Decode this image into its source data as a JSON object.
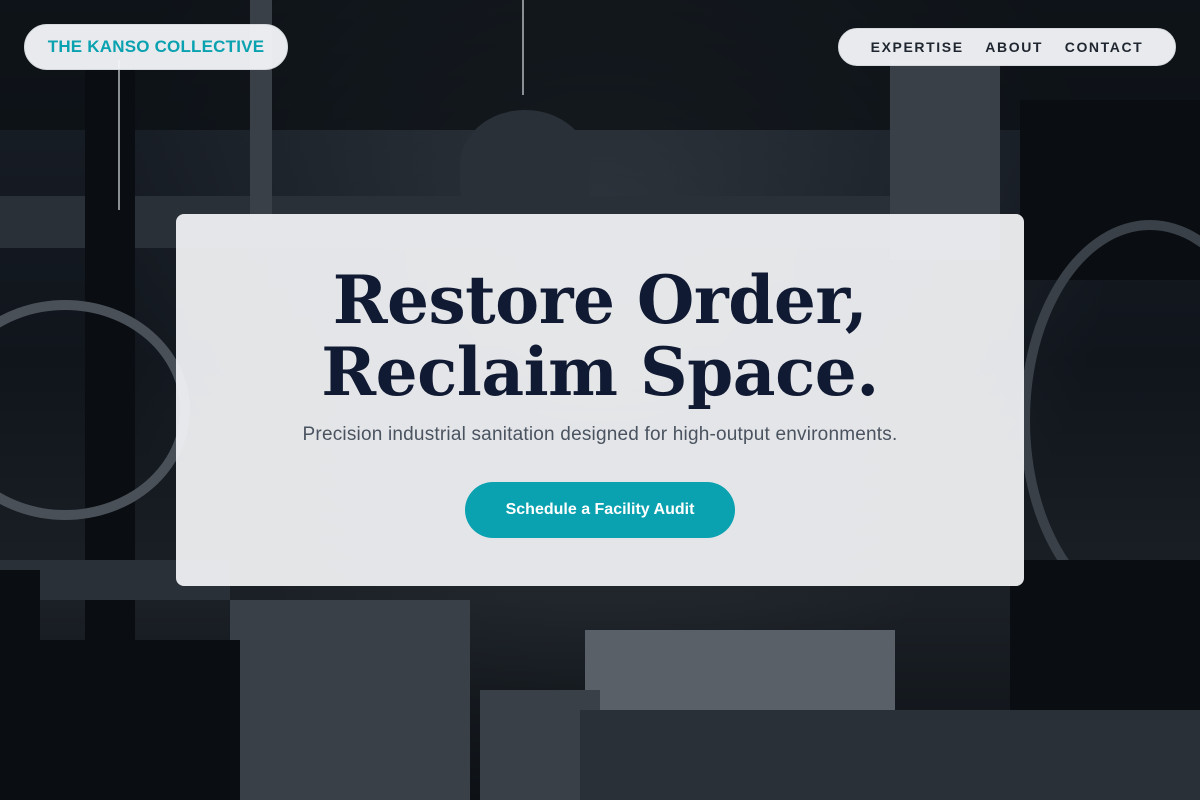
{
  "brand": {
    "name": "THE KANSO COLLECTIVE"
  },
  "nav": {
    "items": [
      "EXPERTISE",
      "ABOUT",
      "CONTACT"
    ]
  },
  "hero": {
    "title_line1": "Restore Order,",
    "title_line2": "Reclaim Space.",
    "subtitle": "Precision industrial sanitation designed for high-output environments.",
    "cta_label": "Schedule a Facility Audit"
  },
  "colors": {
    "accent": "#0aa2b0",
    "title": "#111a33",
    "card": "#f3f4f6"
  }
}
